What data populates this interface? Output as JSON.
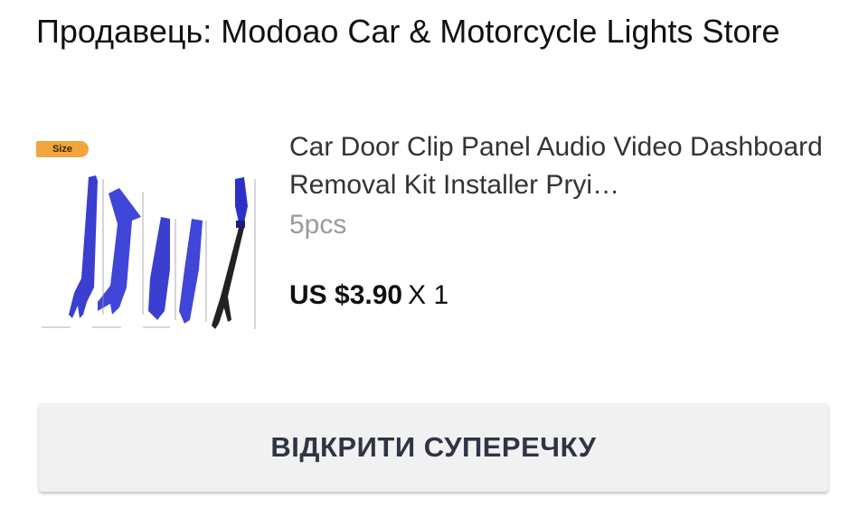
{
  "seller": {
    "label": "Продавець: Modoao Car & Motorcycle Lights Store"
  },
  "product": {
    "image_icon": "pry-tool-kit-image",
    "size_tag": "Size",
    "title": "Car Door Clip Panel Audio Video Dashboard Removal Kit Installer Pryi…",
    "variant": "5pcs",
    "price": "US $3.90",
    "quantity": "X 1"
  },
  "actions": {
    "open_dispute_label": "ВІДКРИТИ СУПЕРЕЧКУ"
  },
  "colors": {
    "tool_blue": "#3a3fd0",
    "size_tag": "#f1a53c",
    "button_bg": "#f1f1f1",
    "button_text": "#2f3542"
  }
}
